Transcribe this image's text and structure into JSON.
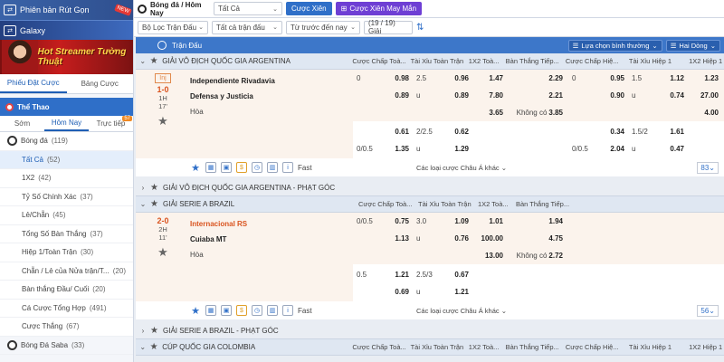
{
  "sidebar": {
    "promo1": "Phiên bản Rút Gọn",
    "promo1_badge": "NEW",
    "promo2": "Galaxy",
    "banner_text": "Hot Streamer Tường Thuật",
    "bet_tabs": [
      "Phiếu Đặt Cược",
      "Bảng Cược"
    ],
    "sport_title": "Thể Thao",
    "time_tabs": [
      "Sớm",
      "Hôm Nay",
      "Trực tiếp"
    ],
    "live_count": "57",
    "menu": [
      {
        "label": "Bóng đá",
        "count": "(119)"
      },
      {
        "label": "Tất Cả",
        "count": "(52)"
      },
      {
        "label": "1X2",
        "count": "(42)"
      },
      {
        "label": "Tỷ Số Chính Xác",
        "count": "(37)"
      },
      {
        "label": "Lẻ/Chẵn",
        "count": "(45)"
      },
      {
        "label": "Tổng Số Bàn Thắng",
        "count": "(37)"
      },
      {
        "label": "Hiệp 1/Toàn Trận",
        "count": "(30)"
      },
      {
        "label": "Chẵn / Lẻ của Nửa trận/T...",
        "count": "(20)"
      },
      {
        "label": "Bàn thắng Đầu/ Cuối",
        "count": "(20)"
      },
      {
        "label": "Cá Cược Tổng Hợp",
        "count": "(491)"
      },
      {
        "label": "Cược Thắng",
        "count": "(67)"
      },
      {
        "label": "Bóng Đá Saba",
        "count": "(33)"
      }
    ]
  },
  "toolbar": {
    "title": "Bóng đá / Hôm Nay",
    "select_all": "Tất Cả",
    "btn_parlay": "Cược Xiên",
    "btn_lucky": "Cược Xiên May Mắn"
  },
  "filters": {
    "league_filter": "Bộ Lọc Trận Đấu",
    "all_matches": "Tất cả trận đấu",
    "sort": "Từ trước đến nay",
    "count": "(19 / 19) Giải"
  },
  "section": {
    "label": "Trận Đấu",
    "odds_type": "Lựa chọn bình thường",
    "view": "Hai Dòng"
  },
  "columns": [
    "Cược Chấp Toà...",
    "Tài Xỉu Toàn Trận",
    "1X2 Toà...",
    "Bàn Thắng Tiếp...",
    "Cược Chấp Hiệ...",
    "Tài Xỉu Hiệp 1",
    "1X2 Hiệp 1"
  ],
  "leagues": [
    {
      "name": "GIẢI VÔ ĐỊCH QUỐC GIA ARGENTINA"
    },
    {
      "name": "GIẢI VÔ ĐỊCH QUỐC GIA ARGENTINA - PHẠT GÓC"
    },
    {
      "name": "GIẢI SERIE A BRAZIL"
    },
    {
      "name": "GIẢI SERIE A BRAZIL - PHẠT GÓC"
    },
    {
      "name": "CÚP QUỐC GIA COLOMBIA"
    }
  ],
  "match1": {
    "inj": "Inj",
    "score": "1-0",
    "half": "1H",
    "minute": "17'",
    "home": "Independiente Rivadavia",
    "away": "Defensa y Justicia",
    "draw": "Hòa",
    "r1": {
      "hdp": "0",
      "hv": "0.98",
      "ou": "2.5",
      "ov": "0.96",
      "x": "1.47",
      "sc": "2.29",
      "hdp1": "0",
      "hv1": "0.95",
      "ou1": "1.5",
      "ov1": "1.12",
      "x1": "1.23"
    },
    "r2": {
      "hv": "0.89",
      "ou": "u",
      "ov": "0.89",
      "x": "7.80",
      "sc": "2.21",
      "hv1": "0.90",
      "ou1": "u",
      "ov1": "0.74",
      "x1": "27.00"
    },
    "r3": {
      "x": "3.65",
      "sc_lbl": "Không có",
      "sc": "3.85",
      "x1": "4.00"
    },
    "r4": {
      "hv": "0.61",
      "ou": "2/2.5",
      "ov": "0.62",
      "hv1": "0.34",
      "ou1": "1.5/2",
      "ov1": "1.61"
    },
    "r5": {
      "hdp": "0/0.5",
      "hv": "1.35",
      "ou": "u",
      "ov": "1.29",
      "hdp1": "0/0.5",
      "hv1": "2.04",
      "ou1": "u",
      "ov1": "0.47"
    },
    "more": "Các loại cược Châu Á khác",
    "page": "83",
    "fast": "Fast"
  },
  "match2": {
    "score": "2-0",
    "half": "2H",
    "minute": "11'",
    "home": "Internacional RS",
    "away": "Cuiaba MT",
    "draw": "Hòa",
    "r1": {
      "hdp": "0/0.5",
      "hv": "0.75",
      "ou": "3.0",
      "ov": "1.09",
      "x": "1.01",
      "sc": "1.94"
    },
    "r2": {
      "hv": "1.13",
      "ou": "u",
      "ov": "0.76",
      "x": "100.00",
      "sc": "4.75"
    },
    "r3": {
      "x": "13.00",
      "sc_lbl": "Không có",
      "sc": "2.72"
    },
    "r4": {
      "hdp": "0.5",
      "hv": "1.21",
      "ou": "2.5/3",
      "ov": "0.67"
    },
    "r5": {
      "hv": "0.69",
      "ou": "u",
      "ov": "1.21"
    },
    "more": "Các loại cược Châu Á khác",
    "page": "56",
    "fast": "Fast"
  }
}
